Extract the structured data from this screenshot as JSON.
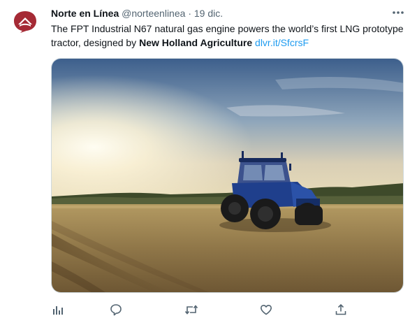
{
  "tweet": {
    "author_name": "Norte en Línea",
    "author_handle": "@norteenlinea",
    "separator": "·",
    "date": "19 dic.",
    "text_intro": "The FPT Industrial N67 natural gas engine powers the world’s first LNG prototype tractor, designed by ",
    "text_bold": "New Holland Agriculture",
    "link": "dlvr.it/SfcrsF"
  },
  "colors": {
    "brand": "#a52a35",
    "link": "#1d9bf0",
    "secondary_text": "#536471",
    "tractor": "#1f3f8c"
  },
  "icons": {
    "more": "more-horizontal-icon",
    "analytics": "analytics-icon",
    "reply": "reply-icon",
    "retweet": "retweet-icon",
    "like": "heart-icon",
    "share": "share-icon"
  }
}
